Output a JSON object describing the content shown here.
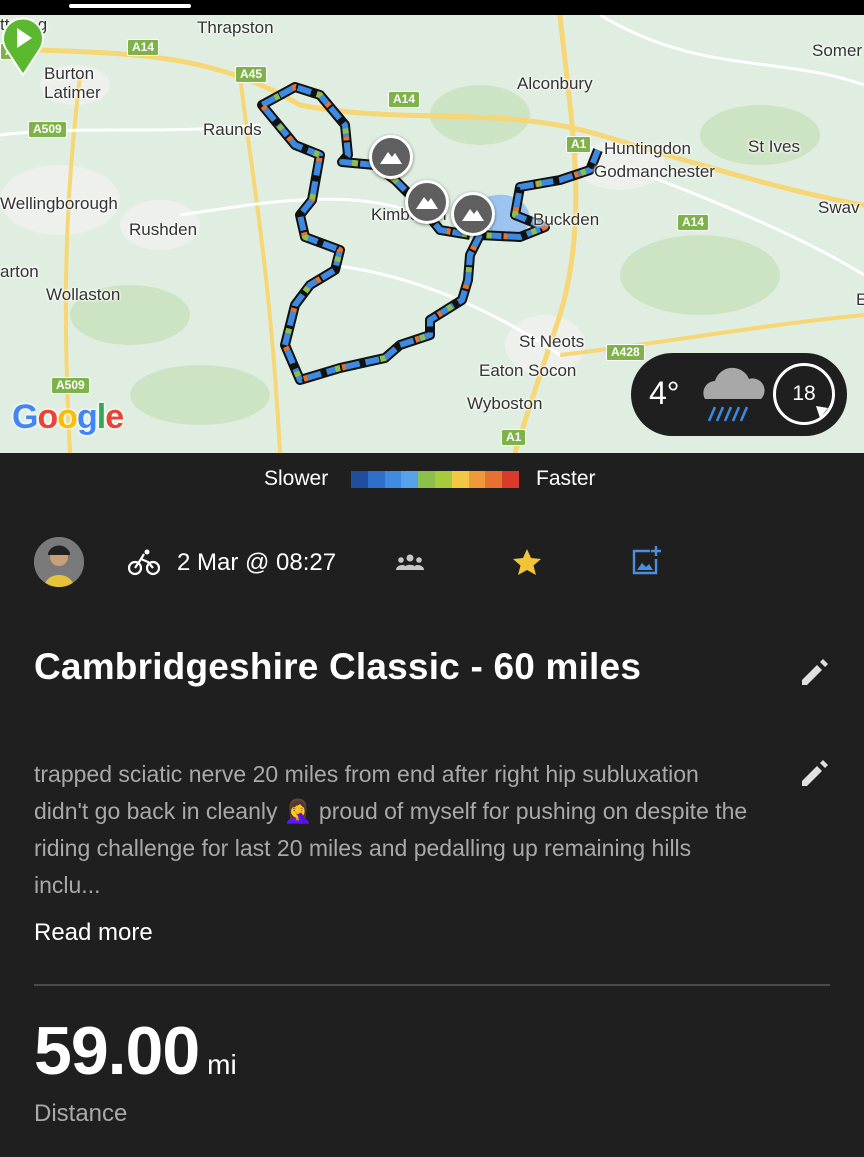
{
  "map": {
    "places": [
      {
        "name": "ttering"
      },
      {
        "name": "Thrapston"
      },
      {
        "name": "Somer"
      },
      {
        "name": "Burton\nLatimer"
      },
      {
        "name": "Alconbury"
      },
      {
        "name": "Raunds"
      },
      {
        "name": "Huntingdon"
      },
      {
        "name": "St Ives"
      },
      {
        "name": "Godmanchester"
      },
      {
        "name": "Wellingborough"
      },
      {
        "name": "Kimbolton"
      },
      {
        "name": "Buckden"
      },
      {
        "name": "Swav"
      },
      {
        "name": "Rushden"
      },
      {
        "name": "arton"
      },
      {
        "name": "Wollaston"
      },
      {
        "name": "E"
      },
      {
        "name": "St Neots"
      },
      {
        "name": "Eaton Socon"
      },
      {
        "name": "Wyboston"
      }
    ],
    "roads": [
      "A14",
      "A14",
      "A45",
      "A14",
      "A509",
      "A1",
      "A14",
      "A428",
      "A509",
      "A1",
      "A14",
      "A1",
      "A1"
    ],
    "peaks_icon": "mountain-icon",
    "start_icon": "play-icon",
    "logo": "Google",
    "logo_colors": [
      "#4285f4",
      "#ea4335",
      "#fbbc05",
      "#4285f4",
      "#34a853",
      "#ea4335"
    ]
  },
  "weather": {
    "temperature": "4°",
    "wind_speed": "18",
    "icon": "rain-cloud-icon"
  },
  "legend": {
    "slower": "Slower",
    "faster": "Faster",
    "colors": [
      "#1f4e9c",
      "#2f6fcc",
      "#3d8ae0",
      "#55a3ea",
      "#8cc04a",
      "#a6cc3e",
      "#f2c744",
      "#ee9a3a",
      "#e5732f",
      "#d93a2b"
    ]
  },
  "activity": {
    "sport_icon": "bike-icon",
    "datetime": "2 Mar @ 08:27",
    "group_icon": "group-icon",
    "star_color": "#f3c33a",
    "title": "Cambridgeshire Classic - 60 miles",
    "description": "trapped sciatic nerve 20 miles from end after right hip subluxation didn't go back in cleanly 🤦‍♀️ proud of myself for pushing on despite the riding challenge for last 20 miles and pedalling up remaining hills inclu...",
    "read_more": "Read more",
    "distance_value": "59.00",
    "distance_unit": "mi",
    "distance_label": "Distance"
  }
}
